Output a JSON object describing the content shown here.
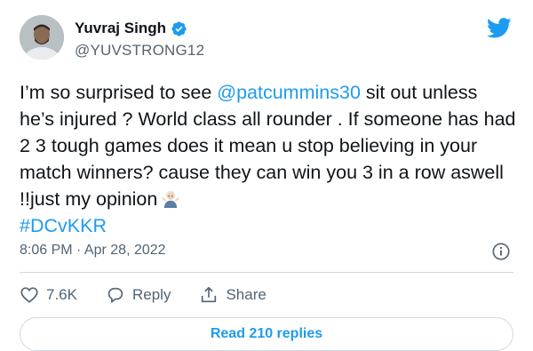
{
  "author": {
    "display_name": "Yuvraj Singh",
    "handle": "@YUVSTRONG12",
    "verified": true
  },
  "tweet": {
    "text_part1": "I’m so surprised to see ",
    "mention": "@patcummins30",
    "text_part2": " sit out unless he’s injured ? World class all rounder . If someone has had 2 3 tough games does it mean u stop believing in your match winners?  cause they can win you 3 in a row aswell  !!just my opinion",
    "emoji": "person-shrugging",
    "hashtag": "#DCvKKR"
  },
  "meta": {
    "timestamp": "8:06 PM · Apr 28, 2022"
  },
  "actions": {
    "likes": "7.6K",
    "reply_label": "Reply",
    "share_label": "Share"
  },
  "replies_button": "Read 210 replies",
  "colors": {
    "accent": "#1d9bf0",
    "text": "#0f1419",
    "secondary": "#536471",
    "border": "#cfd9de"
  },
  "icons": [
    "verified-badge-icon",
    "twitter-bird-icon",
    "info-icon",
    "heart-icon",
    "reply-bubble-icon",
    "share-icon"
  ]
}
